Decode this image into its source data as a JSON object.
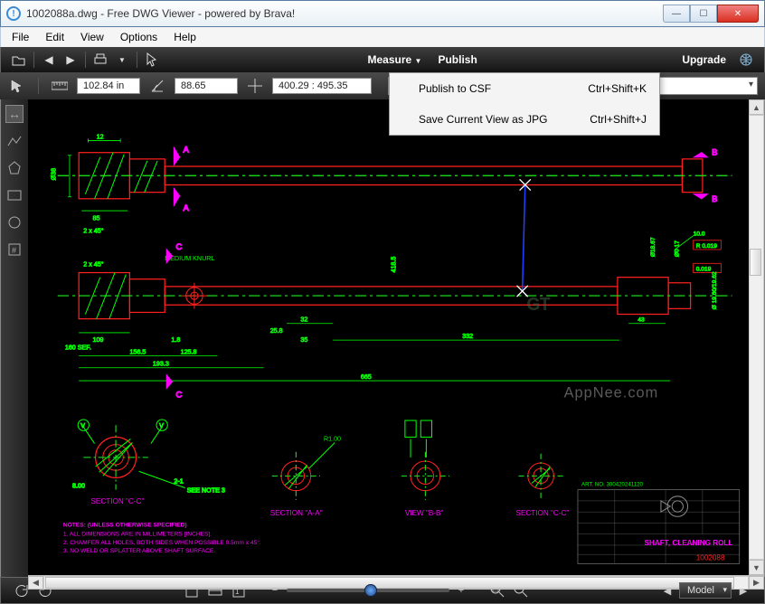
{
  "window": {
    "title": "1002088a.dwg - Free DWG Viewer - powered by Brava!"
  },
  "menu": {
    "file": "File",
    "edit": "Edit",
    "view": "View",
    "options": "Options",
    "help": "Help"
  },
  "toolbar": {
    "measure": "Measure",
    "publish": "Publish",
    "upgrade": "Upgrade"
  },
  "readouts": {
    "dim": "102.84 in",
    "angle": "88.65",
    "coords": "400.29 : 495.35"
  },
  "publish_menu": {
    "items": [
      {
        "label": "Publish to CSF",
        "shortcut": "Ctrl+Shift+K"
      },
      {
        "label": "Save Current View as JPG",
        "shortcut": "Ctrl+Shift+J"
      }
    ]
  },
  "bottom": {
    "model": "Model"
  },
  "drawing": {
    "labels": {
      "A": "A",
      "B": "B",
      "C": "C",
      "section_cc": "SECTION \"C-C\"",
      "section_aa": "SECTION \"A-A\"",
      "view_bb": "VIEW \"B-B\"",
      "see_note": "SEE NOTE 3",
      "medium_knurl": "MEDIUM KNURL",
      "title_block_title": "SHAFT, CLEANING ROLL",
      "art_no": "ART. NO. 300420241120",
      "part_no": "1002088",
      "watermark": "AppNee.com",
      "notes_header": "NOTES: (UNLESS OTHERWISE SPECIFIED)",
      "note1": "1.  ALL DIMENSIONS ARE IN MILLIMETERS [INCHES].",
      "note2": "2.  CHAMFER ALL HOLES, BOTH SIDES WHEN POSSIBLE 0.5mm x 45°.",
      "note3": "3.  NO WELD OR SPLATTER ABOVE SHAFT SURFACE."
    },
    "dims": {
      "d12": "12",
      "d85": "85",
      "d109": "109",
      "d2x45_1": "2 x 45°",
      "d2x45_2": "2 x 45°",
      "d18": "1.8",
      "d156_5": "156.5",
      "d125_8": "125.8",
      "d193_3": "193.3",
      "d32": "32",
      "d665": "665",
      "d35": "35",
      "d332": "332",
      "d25_8": "25.8",
      "d418_5": "418.5",
      "d100": "10.0",
      "d43": "43",
      "d160_sef": "160 SEF.",
      "d017": "Ø0 17",
      "d018_67": "Ø18.67",
      "r019": "R 0.019",
      "d019": "0.019",
      "d019_6": "Ø 19.60/19.62",
      "d800": "8.00",
      "r100": "R1.00",
      "d2_1": "2-1"
    }
  }
}
